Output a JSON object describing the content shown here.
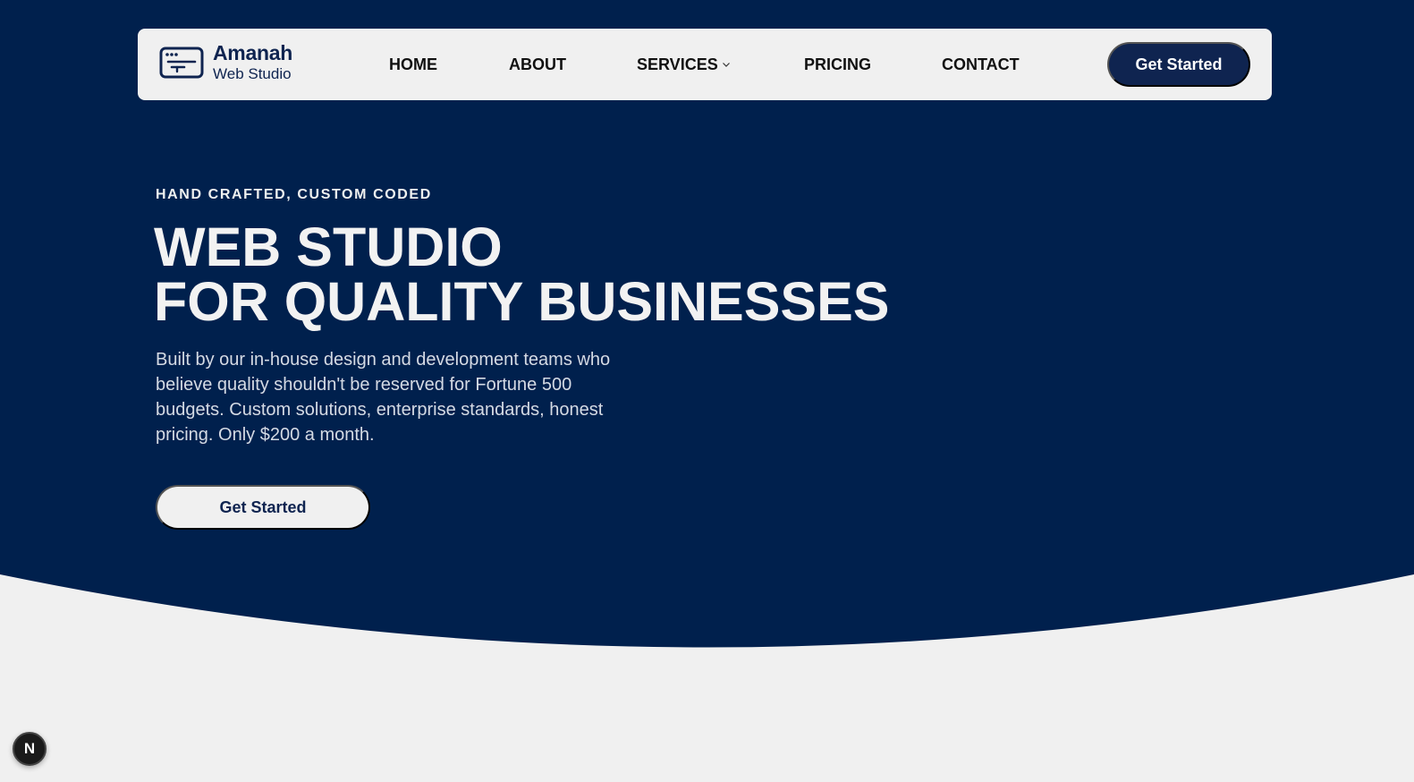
{
  "brand": {
    "name": "Amanah",
    "subtitle": "Web Studio",
    "icon": "browser-window-icon"
  },
  "nav": {
    "items": [
      {
        "label": "HOME"
      },
      {
        "label": "ABOUT"
      },
      {
        "label": "SERVICES",
        "icon": "chevron-down-icon"
      },
      {
        "label": "PRICING"
      },
      {
        "label": "CONTACT"
      }
    ],
    "cta_label": "Get Started"
  },
  "hero": {
    "eyebrow": "HAND CRAFTED, CUSTOM CODED",
    "headline_line1": "WEB STUDIO",
    "headline_line2": "FOR QUALITY BUSINESSES",
    "lead": "Built by our in-house design and development teams who believe quality shouldn't be reserved for Fortune 500 budgets. Custom solutions, enterprise standards, honest pricing. Only $200 a month.",
    "cta_label": "Get Started"
  },
  "dev_badge": {
    "label": "N"
  },
  "colors": {
    "navy": "#00204d",
    "light": "#f0f0f0",
    "brand_text": "#0f2450"
  }
}
